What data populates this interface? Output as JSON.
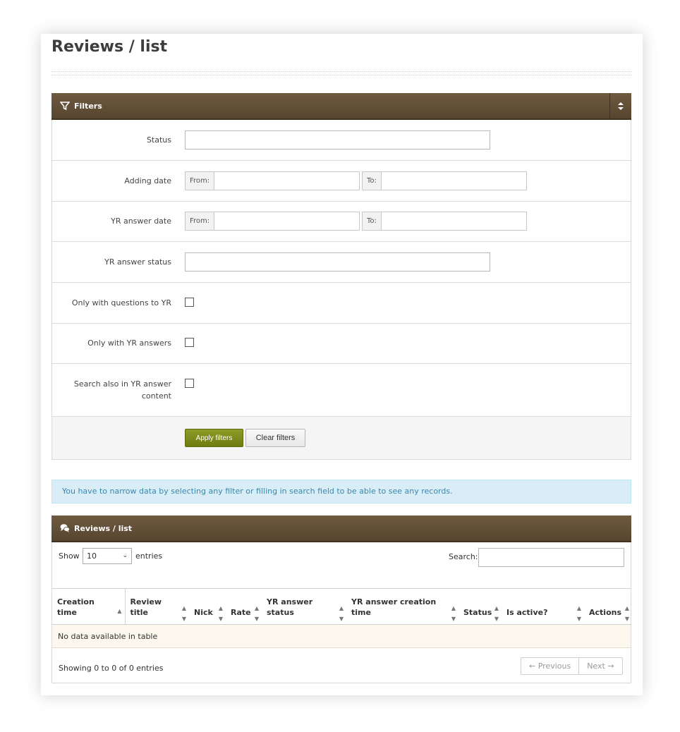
{
  "page_title": "Reviews / list",
  "filters_panel": {
    "title": "Filters",
    "toggle_icon": "sort-icon",
    "rows": [
      {
        "label": "Status"
      },
      {
        "label": "Adding date",
        "from_addon": "From:",
        "to_addon": "To:"
      },
      {
        "label": "YR answer date",
        "from_addon": "From:",
        "to_addon": "To:"
      },
      {
        "label": "YR answer status"
      },
      {
        "label": "Only with questions to YR"
      },
      {
        "label": "Only with YR answers"
      },
      {
        "label_line1": "Search also in YR answer",
        "label_line2": "content"
      }
    ],
    "apply_label": "Apply filters",
    "clear_label": "Clear filters"
  },
  "alert_text": "You have to narrow data by selecting any filter or filling in search field to be able to see any records.",
  "list_panel": {
    "title": "Reviews / list",
    "show_label": "Show",
    "page_length": "10",
    "entries_label": "entries",
    "search_label": "Search:",
    "columns": [
      {
        "line1": "Creation",
        "line2": "time",
        "sort": "asc"
      },
      {
        "line1": "Review",
        "line2": "title",
        "sort": "both"
      },
      {
        "line1": "",
        "line2": "Nick",
        "sort": "both"
      },
      {
        "line1": "",
        "line2": "Rate",
        "sort": "both"
      },
      {
        "line1": "YR answer",
        "line2": "status",
        "sort": "both"
      },
      {
        "line1": "YR answer creation",
        "line2": "time",
        "sort": "both"
      },
      {
        "line1": "",
        "line2": "Status",
        "sort": "both"
      },
      {
        "line1": "",
        "line2": "Is active?",
        "sort": "both"
      },
      {
        "line1": "",
        "line2": "Actions",
        "sort": "both"
      }
    ],
    "empty_text": "No data available in table",
    "info_text": "Showing 0 to 0 of 0 entries",
    "prev_label": "← Previous",
    "next_label": "Next →"
  },
  "colors": {
    "header_bar": "#6e5a40",
    "apply_button": "#7d8b1a",
    "alert_bg": "#d9edf7",
    "alert_text": "#3a87ad",
    "empty_row_bg": "#fcf8ed"
  }
}
